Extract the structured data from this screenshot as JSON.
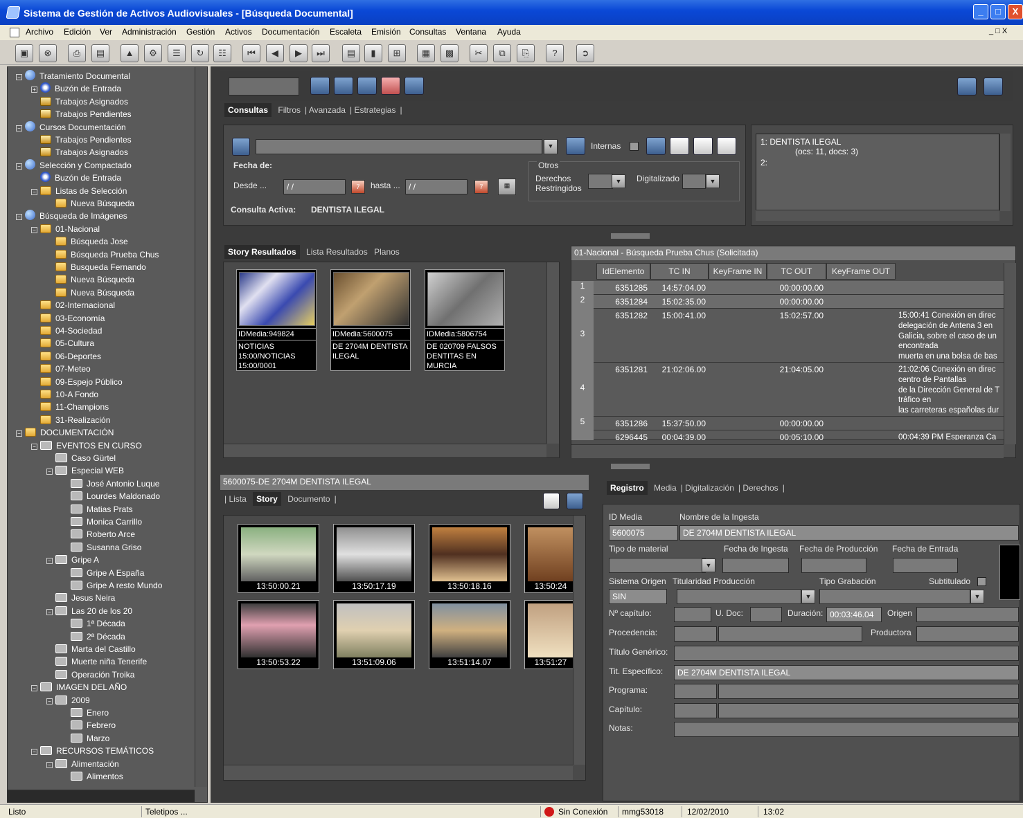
{
  "window": {
    "title": "Sistema de Gestión de Activos Audiovisuales - [Búsqueda Documental]",
    "buttons": [
      "_",
      "□",
      "X"
    ]
  },
  "menu": [
    "Archivo",
    "Edición",
    "Ver",
    "Administración",
    "Gestión",
    "Activos",
    "Documentación",
    "Escaleta",
    "Emisión",
    "Consultas",
    "Ventana",
    "Ayuda"
  ],
  "tree": [
    {
      "label": "Tratamiento Documental",
      "level": 0,
      "icon": "globe-icon",
      "pm": "−"
    },
    {
      "label": "Buzón de Entrada",
      "level": 1,
      "icon": "inbox-icon",
      "pm": "+"
    },
    {
      "label": "Trabajos Asignados",
      "level": 1,
      "icon": "tray-icon",
      "pm": ""
    },
    {
      "label": "Trabajos Pendientes",
      "level": 1,
      "icon": "tray-icon",
      "pm": ""
    },
    {
      "label": "Cursos Documentación",
      "level": 0,
      "icon": "globe-icon",
      "pm": "−"
    },
    {
      "label": "Trabajos Pendientes",
      "level": 1,
      "icon": "tray-icon",
      "pm": ""
    },
    {
      "label": "Trabajos Asignados",
      "level": 1,
      "icon": "tray-icon",
      "pm": ""
    },
    {
      "label": "Selección y Compactado",
      "level": 0,
      "icon": "globe-icon",
      "pm": "−"
    },
    {
      "label": "Buzón de Entrada",
      "level": 1,
      "icon": "inbox-icon",
      "pm": ""
    },
    {
      "label": "Listas de Selección",
      "level": 1,
      "icon": "folder-icon",
      "pm": "−"
    },
    {
      "label": "Nueva Búsqueda",
      "level": 2,
      "icon": "folder-icon",
      "pm": ""
    },
    {
      "label": "Búsqueda de Imágenes",
      "level": 0,
      "icon": "globe-icon",
      "pm": "−"
    },
    {
      "label": "01-Nacional",
      "level": 1,
      "icon": "folder-icon",
      "pm": "−"
    },
    {
      "label": "Búsqueda Jose",
      "level": 2,
      "icon": "folder-icon",
      "pm": ""
    },
    {
      "label": "Búsqueda Prueba Chus",
      "level": 2,
      "icon": "folder-icon",
      "pm": ""
    },
    {
      "label": "Busqueda Fernando",
      "level": 2,
      "icon": "folder-icon",
      "pm": ""
    },
    {
      "label": "Nueva Búsqueda",
      "level": 2,
      "icon": "folder-icon",
      "pm": ""
    },
    {
      "label": "Nueva Búsqueda",
      "level": 2,
      "icon": "folder-icon",
      "pm": ""
    },
    {
      "label": "02-Internacional",
      "level": 1,
      "icon": "folder-icon",
      "pm": ""
    },
    {
      "label": "03-Economía",
      "level": 1,
      "icon": "folder-icon",
      "pm": ""
    },
    {
      "label": "04-Sociedad",
      "level": 1,
      "icon": "folder-icon",
      "pm": ""
    },
    {
      "label": "05-Cultura",
      "level": 1,
      "icon": "folder-icon",
      "pm": ""
    },
    {
      "label": "06-Deportes",
      "level": 1,
      "icon": "folder-icon",
      "pm": ""
    },
    {
      "label": "07-Meteo",
      "level": 1,
      "icon": "folder-icon",
      "pm": ""
    },
    {
      "label": "09-Espejo Público",
      "level": 1,
      "icon": "folder-icon",
      "pm": ""
    },
    {
      "label": "10-A Fondo",
      "level": 1,
      "icon": "folder-icon",
      "pm": ""
    },
    {
      "label": "11-Champions",
      "level": 1,
      "icon": "folder-icon",
      "pm": ""
    },
    {
      "label": "31-Realización",
      "level": 1,
      "icon": "folder-icon",
      "pm": ""
    },
    {
      "label": "DOCUMENTACIÓN",
      "level": 0,
      "icon": "folder-icon",
      "pm": "−"
    },
    {
      "label": "EVENTOS EN CURSO",
      "level": 1,
      "icon": "film-icon",
      "pm": "−"
    },
    {
      "label": "Caso Gürtel",
      "level": 2,
      "icon": "film-icon",
      "pm": ""
    },
    {
      "label": "Especial WEB",
      "level": 2,
      "icon": "film-icon",
      "pm": "−"
    },
    {
      "label": "José Antonio Luque",
      "level": 3,
      "icon": "film-icon",
      "pm": ""
    },
    {
      "label": "Lourdes Maldonado",
      "level": 3,
      "icon": "film-icon",
      "pm": ""
    },
    {
      "label": "Matias Prats",
      "level": 3,
      "icon": "film-icon",
      "pm": ""
    },
    {
      "label": "Monica Carrillo",
      "level": 3,
      "icon": "film-icon",
      "pm": ""
    },
    {
      "label": "Roberto Arce",
      "level": 3,
      "icon": "film-icon",
      "pm": ""
    },
    {
      "label": "Susanna Griso",
      "level": 3,
      "icon": "film-icon",
      "pm": ""
    },
    {
      "label": "Gripe A",
      "level": 2,
      "icon": "film-icon",
      "pm": "−"
    },
    {
      "label": "Gripe A España",
      "level": 3,
      "icon": "film-icon",
      "pm": ""
    },
    {
      "label": "Gripe A resto Mundo",
      "level": 3,
      "icon": "film-icon",
      "pm": ""
    },
    {
      "label": "Jesus Neira",
      "level": 2,
      "icon": "film-icon",
      "pm": ""
    },
    {
      "label": "Las 20 de los 20",
      "level": 2,
      "icon": "film-icon",
      "pm": "−"
    },
    {
      "label": "1ª Década",
      "level": 3,
      "icon": "film-icon",
      "pm": ""
    },
    {
      "label": "2ª Década",
      "level": 3,
      "icon": "film-icon",
      "pm": ""
    },
    {
      "label": "Marta del Castillo",
      "level": 2,
      "icon": "film-icon",
      "pm": ""
    },
    {
      "label": "Muerte niña Tenerife",
      "level": 2,
      "icon": "film-icon",
      "pm": ""
    },
    {
      "label": "Operación Troika",
      "level": 2,
      "icon": "film-icon",
      "pm": ""
    },
    {
      "label": "IMAGEN DEL AÑO",
      "level": 1,
      "icon": "film-icon",
      "pm": "−"
    },
    {
      "label": "2009",
      "level": 2,
      "icon": "film-icon",
      "pm": "−"
    },
    {
      "label": "Enero",
      "level": 3,
      "icon": "film-icon",
      "pm": ""
    },
    {
      "label": "Febrero",
      "level": 3,
      "icon": "film-icon",
      "pm": ""
    },
    {
      "label": "Marzo",
      "level": 3,
      "icon": "film-icon",
      "pm": ""
    },
    {
      "label": "RECURSOS TEMÁTICOS",
      "level": 1,
      "icon": "film-icon",
      "pm": "−"
    },
    {
      "label": "Alimentación",
      "level": 2,
      "icon": "film-icon",
      "pm": "−"
    },
    {
      "label": "Alimentos",
      "level": 3,
      "icon": "film-icon",
      "pm": ""
    }
  ],
  "search": {
    "tabs": [
      "Consultas",
      "Filtros",
      "Avanzada",
      "Estrategias"
    ],
    "internas_label": "Internas",
    "fecha_label": "Fecha de:",
    "desde_label": "Desde ...",
    "desde_value": "/ /",
    "hasta_label": "hasta ...",
    "hasta_value": "/ /",
    "otros_label": "Otros",
    "derechos_label": "Derechos Restringidos",
    "digitalizado_label": "Digitalizado",
    "consulta_activa_label": "Consulta Activa:",
    "consulta_activa_value": "DENTISTA ILEGAL",
    "history_1": "1: DENTISTA ILEGAL",
    "history_1b": "(ocs: 11, docs: 3)",
    "history_2": "2:"
  },
  "results": {
    "tabs": [
      "Story Resultados",
      "Lista Resultados",
      "Planos"
    ],
    "items": [
      {
        "id": "IDMedia:949824",
        "desc": "NOTICIAS 15:00/NOTICIAS 15:00/0001"
      },
      {
        "id": "IDMedia:5600075",
        "desc": "DE 2704M DENTISTA ILEGAL"
      },
      {
        "id": "IDMedia:5806754",
        "desc": "DE 020709 FALSOS DENTITAS EN MURCIA"
      }
    ]
  },
  "grid": {
    "title": "01-Nacional - Búsqueda Prueba Chus (Solicitada)",
    "headers": [
      "IdElemento",
      "TC IN",
      "KeyFrame IN",
      "TC OUT",
      "KeyFrame OUT"
    ],
    "rows": [
      {
        "n": "1",
        "id": "6351285",
        "tcin": "14:57:04.00",
        "tcout": "00:00:00.00",
        "desc": ""
      },
      {
        "n": "2",
        "id": "6351284",
        "tcin": "15:02:35.00",
        "tcout": "00:00:00.00",
        "desc": ""
      },
      {
        "n": "3",
        "id": "6351282",
        "tcin": "15:00:41.00",
        "tcout": "15:02:57.00",
        "desc": "15:00:41 Conexión en direc\ndelegación de Antena 3 en\nGalicia, sobre el caso de un\nencontrada\nmuerta en una bolsa de bas"
      },
      {
        "n": "4",
        "id": "6351281",
        "tcin": "21:02:06.00",
        "tcout": "21:04:05.00",
        "desc": "21:02:06 Conexión en direc\ncentro de Pantallas\nde la Dirección General de T\ntráfico en\nlas carreteras españolas dur"
      },
      {
        "n": "5",
        "id": "6351286",
        "tcin": "15:37:50.00",
        "tcout": "00:00:00.00",
        "desc": ""
      },
      {
        "n": "",
        "id": "6296445",
        "tcin": "00:04:39.00",
        "tcout": "00:05:10.00",
        "desc": "00:04:39 PM Esperanza Ca"
      }
    ]
  },
  "story": {
    "title": "5600075-DE 2704M DENTISTA ILEGAL",
    "tabs": [
      "Lista",
      "Story",
      "Documento"
    ],
    "keyframes": [
      "13:50:00.21",
      "13:50:17.19",
      "13:50:18.16",
      "13:50:24",
      "13:50:53.22",
      "13:51:09.06",
      "13:51:14.07",
      "13:51:27"
    ]
  },
  "record": {
    "tabs": [
      "Registro",
      "Media",
      "Digitalización",
      "Derechos"
    ],
    "id_media_label": "ID Media",
    "id_media": "5600075",
    "nombre_label": "Nombre de la Ingesta",
    "nombre": "DE 2704M DENTISTA ILEGAL",
    "tipo_material_label": "Tipo de material",
    "fecha_ingesta_label": "Fecha de Ingesta",
    "fecha_produccion_label": "Fecha de Producción",
    "fecha_entrada_label": "Fecha de Entrada",
    "sistema_origen_label": "Sistema Origen",
    "sistema_origen": "SIN",
    "titularidad_label": "Titularidad Producción",
    "tipo_grabacion_label": "Tipo Grabación",
    "subtitulado_label": "Subtitulado",
    "capitulo_label": "Nº capítulo:",
    "udoc_label": "U. Doc:",
    "duracion_label": "Duración:",
    "duracion": "00:03:46.04",
    "origen_label": "Origen",
    "procedencia_label": "Procedencia:",
    "productora_label": "Productora",
    "titulo_generico_label": "Título Genérico:",
    "tit_especifico_label": "Tit. Específico:",
    "tit_especifico": "DE 2704M DENTISTA ILEGAL",
    "programa_label": "Programa:",
    "capitulo2_label": "Capítulo:",
    "notas_label": "Notas:"
  },
  "status": {
    "listo": "Listo",
    "teletipos": "Teletipos ...",
    "conexion": "Sin Conexión",
    "user": "mmg53018",
    "date": "12/02/2010",
    "time": "13:02"
  }
}
